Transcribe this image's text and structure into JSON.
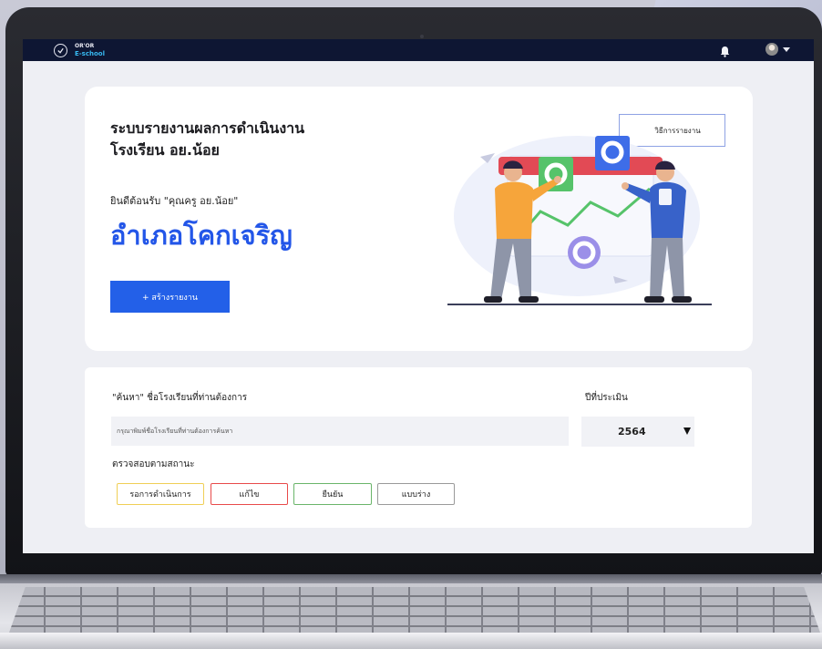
{
  "app": {
    "logo_top": "OR'OR",
    "logo_bottom": "E-school",
    "icons": [
      "logo-icon",
      "bell-icon",
      "avatar",
      "chevron-down-icon"
    ]
  },
  "hero": {
    "title_line1": "ระบบรายงานผลการดำเนินงาน",
    "title_line2": "โรงเรียน อย.น้อย",
    "welcome": "ยินดีต้อนรับ \"คุณครู อย.น้อย\"",
    "district": "อำเภอโคกเจริญ",
    "create_button": "+ สร้างรายงาน",
    "howto_button": "วิธีการรายงาน"
  },
  "search": {
    "label": "\"ค้นหา\" ชื่อโรงเรียนที่ท่านต้องการ",
    "placeholder": "กรุณาพิมพ์ชื่อโรงเรียนที่ท่านต้องการค้นหา",
    "value": "",
    "year_label": "ปีที่ประเมิน",
    "year_value": "2564",
    "status_label": "ตรวจสอบตามสถานะ",
    "statuses": [
      {
        "label": "รอการดำเนินการ",
        "color": "#f0cf56"
      },
      {
        "label": "แก้ไข",
        "color": "#e84a4a"
      },
      {
        "label": "ยืนยัน",
        "color": "#6ab56a"
      },
      {
        "label": "แบบร่าง",
        "color": "#9a9a9a"
      }
    ]
  },
  "colors": {
    "topbar": "#0e1633",
    "accent": "#2356e8",
    "button": "#2360e8"
  }
}
